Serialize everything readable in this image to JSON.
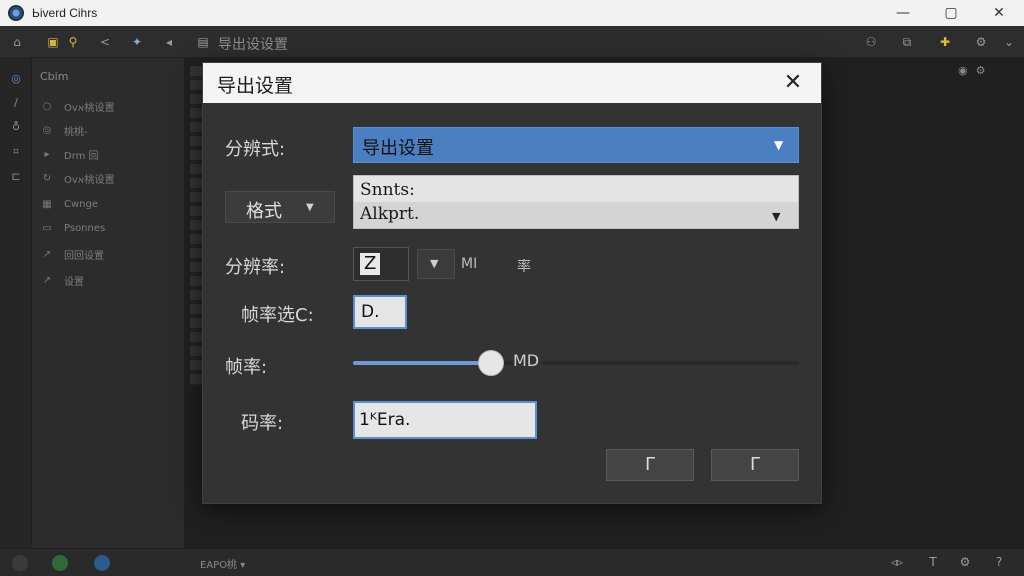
{
  "app": {
    "title": "Ьiverd Cihrs"
  },
  "window_controls": {
    "minimize": "—",
    "maximize": "▢",
    "close": "✕"
  },
  "toolbar": {
    "label": "导出设设置"
  },
  "sidepanel": {
    "header": "Cbim",
    "items": [
      {
        "icon": "○",
        "label": "Ovא桃设置"
      },
      {
        "icon": "◎",
        "label": "桃桃-"
      },
      {
        "icon": "▸",
        "label": "Drm 回"
      },
      {
        "icon": "↻",
        "label": "Ovא桃设置"
      },
      {
        "icon": "▦",
        "label": "Cwnge"
      },
      {
        "icon": "▭",
        "label": "Psonnes"
      },
      {
        "icon": "↗",
        "label": "回回设置"
      },
      {
        "icon": "↗",
        "label": "设置"
      }
    ]
  },
  "status": {
    "timecode": "EAPO桃 ▾"
  },
  "dialog": {
    "title": "导出设置",
    "close": "✕",
    "resolution": {
      "label": "分辨式:",
      "value": "导出设置",
      "arrow": "▼"
    },
    "format": {
      "label": "格式",
      "arrow": "▼"
    },
    "preset": {
      "line1": "Snnts:",
      "line2": "Alkprt.",
      "arrow": "▼"
    },
    "ratio": {
      "label": "分辨率:",
      "value": "Z",
      "arrow": "▼",
      "unit": "MΙ",
      "suffix": "率"
    },
    "fps_choice": {
      "label": "帧率选C:",
      "value": "D."
    },
    "fps": {
      "label": "帧率:",
      "readout": "MD",
      "level": 0.31
    },
    "bitrate": {
      "label": "码率:",
      "value": "1ᴷEra."
    },
    "buttons": {
      "left": "Γ",
      "right": "Γ"
    }
  }
}
